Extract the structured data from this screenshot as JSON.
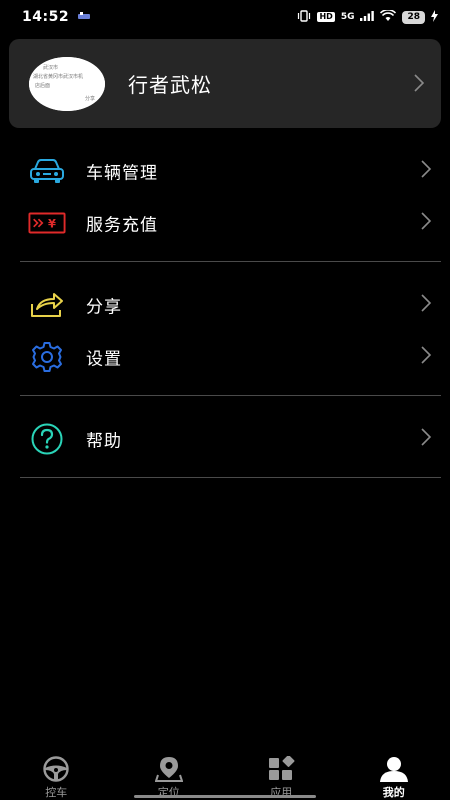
{
  "status_bar": {
    "time": "14:52",
    "hd": "HD",
    "network": "5G",
    "battery": "28"
  },
  "profile": {
    "name": "行者武松",
    "avatar_lines": [
      "武汉市",
      "湖北省黄冈市武汉市机",
      "店后面",
      "分享"
    ]
  },
  "menu": {
    "vehicle": {
      "label": "车辆管理",
      "icon": "car-icon",
      "color": "#2aa9e0"
    },
    "recharge": {
      "label": "服务充值",
      "icon": "ticket-icon",
      "color": "#e02a2a"
    },
    "share": {
      "label": "分享",
      "icon": "share-icon",
      "color": "#e8d24a"
    },
    "settings": {
      "label": "设置",
      "icon": "gear-icon",
      "color": "#2a6de0"
    },
    "help": {
      "label": "帮助",
      "icon": "question-icon",
      "color": "#2ad4b8"
    }
  },
  "bottom_nav": {
    "tabs": [
      {
        "label": "控车",
        "icon": "steering-wheel-icon",
        "active": false
      },
      {
        "label": "定位",
        "icon": "location-pin-icon",
        "active": false
      },
      {
        "label": "应用",
        "icon": "apps-grid-icon",
        "active": false
      },
      {
        "label": "我的",
        "icon": "user-icon",
        "active": true
      }
    ]
  },
  "colors": {
    "background": "#000000",
    "card": "#262626",
    "divider": "#4a4a4a",
    "chevron": "#8a8a8a"
  }
}
